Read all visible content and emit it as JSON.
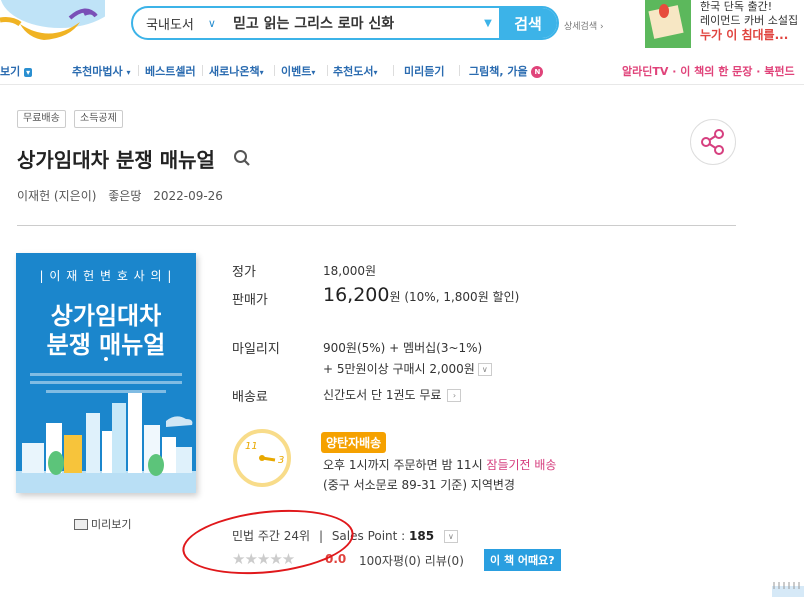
{
  "search": {
    "category": "국내도서",
    "query": "믿고 읽는 그리스 로마 신화",
    "button": "검색",
    "advanced": "상세검색"
  },
  "promo": {
    "line1": "한국 단독 출간!",
    "line2": "레이먼드 카버 소설집",
    "line3": "누가 이 침대를..."
  },
  "nav": {
    "items": [
      "보기",
      "추천마법사",
      "베스트셀러",
      "새로나온책",
      "이벤트",
      "추천도서",
      "미리듣기",
      "그림책, 가을"
    ],
    "right": "알라딘TV · 이 책의 한 문장 · 북펀드",
    "new_badge": "N"
  },
  "tags": [
    "무료배송",
    "소득공제"
  ],
  "book": {
    "title": "상가임대차 분쟁 매뉴얼",
    "author": "이재헌 (지은이)",
    "publisher": "좋은땅",
    "date": "2022-09-26",
    "cover": {
      "top_label": "| 이 재 헌   변 호 사 의 |",
      "title_line1": "상가임대차",
      "title_line2": "분쟁 매뉴얼"
    },
    "preview": "미리보기"
  },
  "price": {
    "list_label": "정가",
    "list_value": "18,000원",
    "sale_label": "판매가",
    "sale_value": "16,200",
    "sale_unit": "원",
    "discount": "(10%, 1,800원 할인)",
    "mileage_label": "마일리지",
    "mileage_line1": "900원(5%) + 멤버십(3~1%)",
    "mileage_line2": "+ 5만원이상 구매시 2,000원",
    "shipping_label": "배송료",
    "shipping_value": "신간도서 단 1권도 무료"
  },
  "delivery": {
    "clock_11": "11",
    "clock_3": "3",
    "badge": "양탄자배송",
    "line1_a": "오후 1시까지 주문하면 밤 11시 ",
    "line1_b": "잠들기전 배송",
    "line2": "(중구 서소문로 89-31 기준) 지역변경"
  },
  "rank": {
    "text": "민법 주간 24위",
    "sep": "|",
    "sales_label": "Sales Point :",
    "sales_value": "185",
    "score": "0.0",
    "reviews": "100자평(0)   리뷰(0)",
    "how_button": "이 책 어때요?"
  },
  "colors": {
    "accent": "#3cb3e8",
    "nav_blue": "#2a6bb0",
    "pink": "#d63f7f",
    "orange_badge": "#f5a100",
    "annotation_red": "#e0181b"
  }
}
